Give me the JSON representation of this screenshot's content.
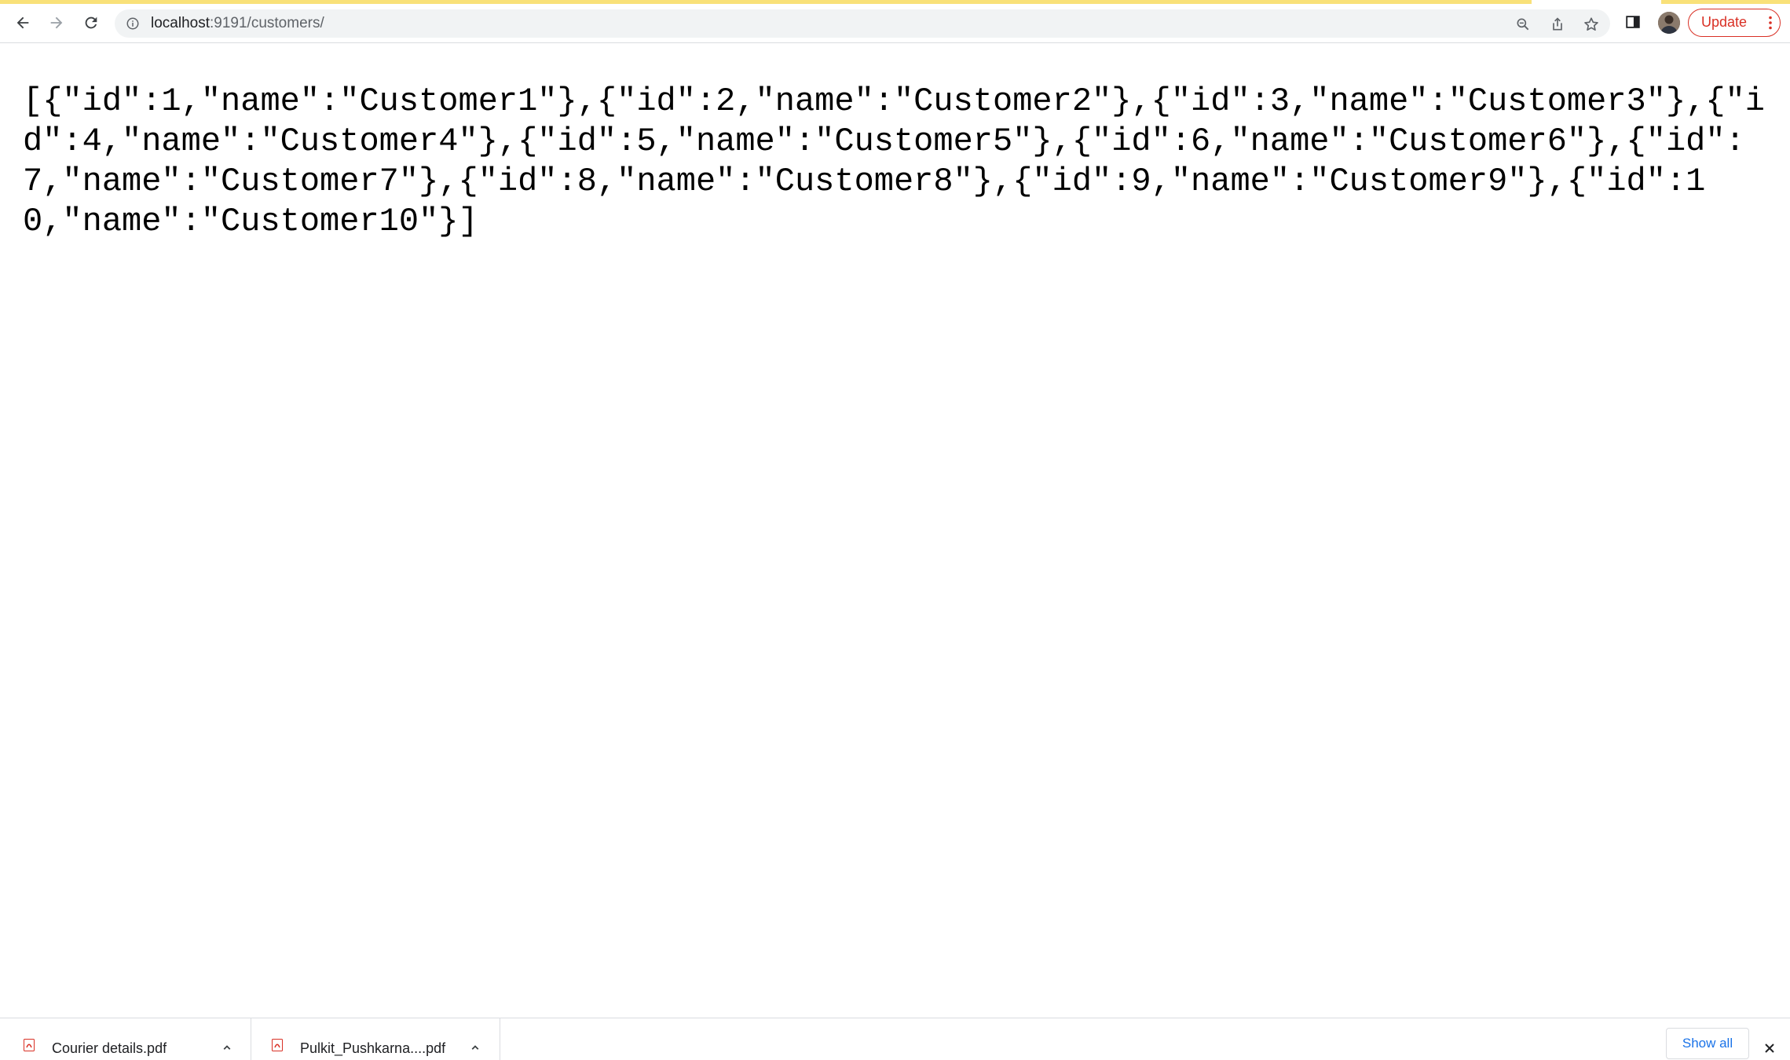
{
  "browser": {
    "url_host": "localhost",
    "url_path": ":9191/customers/",
    "update_label": "Update",
    "theme": {
      "loading_bar": "#f9e179",
      "update_red": "#d93025",
      "link_blue": "#1a73e8"
    }
  },
  "icons": {
    "back": "back-arrow-icon",
    "forward": "forward-arrow-icon",
    "reload": "reload-icon",
    "info": "info-icon",
    "zoom": "zoom-icon",
    "share": "share-icon",
    "bookmark": "star-icon",
    "side_panel": "side-panel-icon",
    "avatar": "profile-avatar",
    "menu": "kebab-menu-icon"
  },
  "page": {
    "json_text": "[{\"id\":1,\"name\":\"Customer1\"},{\"id\":2,\"name\":\"Customer2\"},{\"id\":3,\"name\":\"Customer3\"},{\"id\":4,\"name\":\"Customer4\"},{\"id\":5,\"name\":\"Customer5\"},{\"id\":6,\"name\":\"Customer6\"},{\"id\":7,\"name\":\"Customer7\"},{\"id\":8,\"name\":\"Customer8\"},{\"id\":9,\"name\":\"Customer9\"},{\"id\":10,\"name\":\"Customer10\"}]"
  },
  "downloads": {
    "items": [
      {
        "name": "Courier details.pdf"
      },
      {
        "name": "Pulkit_Pushkarna....pdf"
      }
    ],
    "show_all_label": "Show all"
  }
}
